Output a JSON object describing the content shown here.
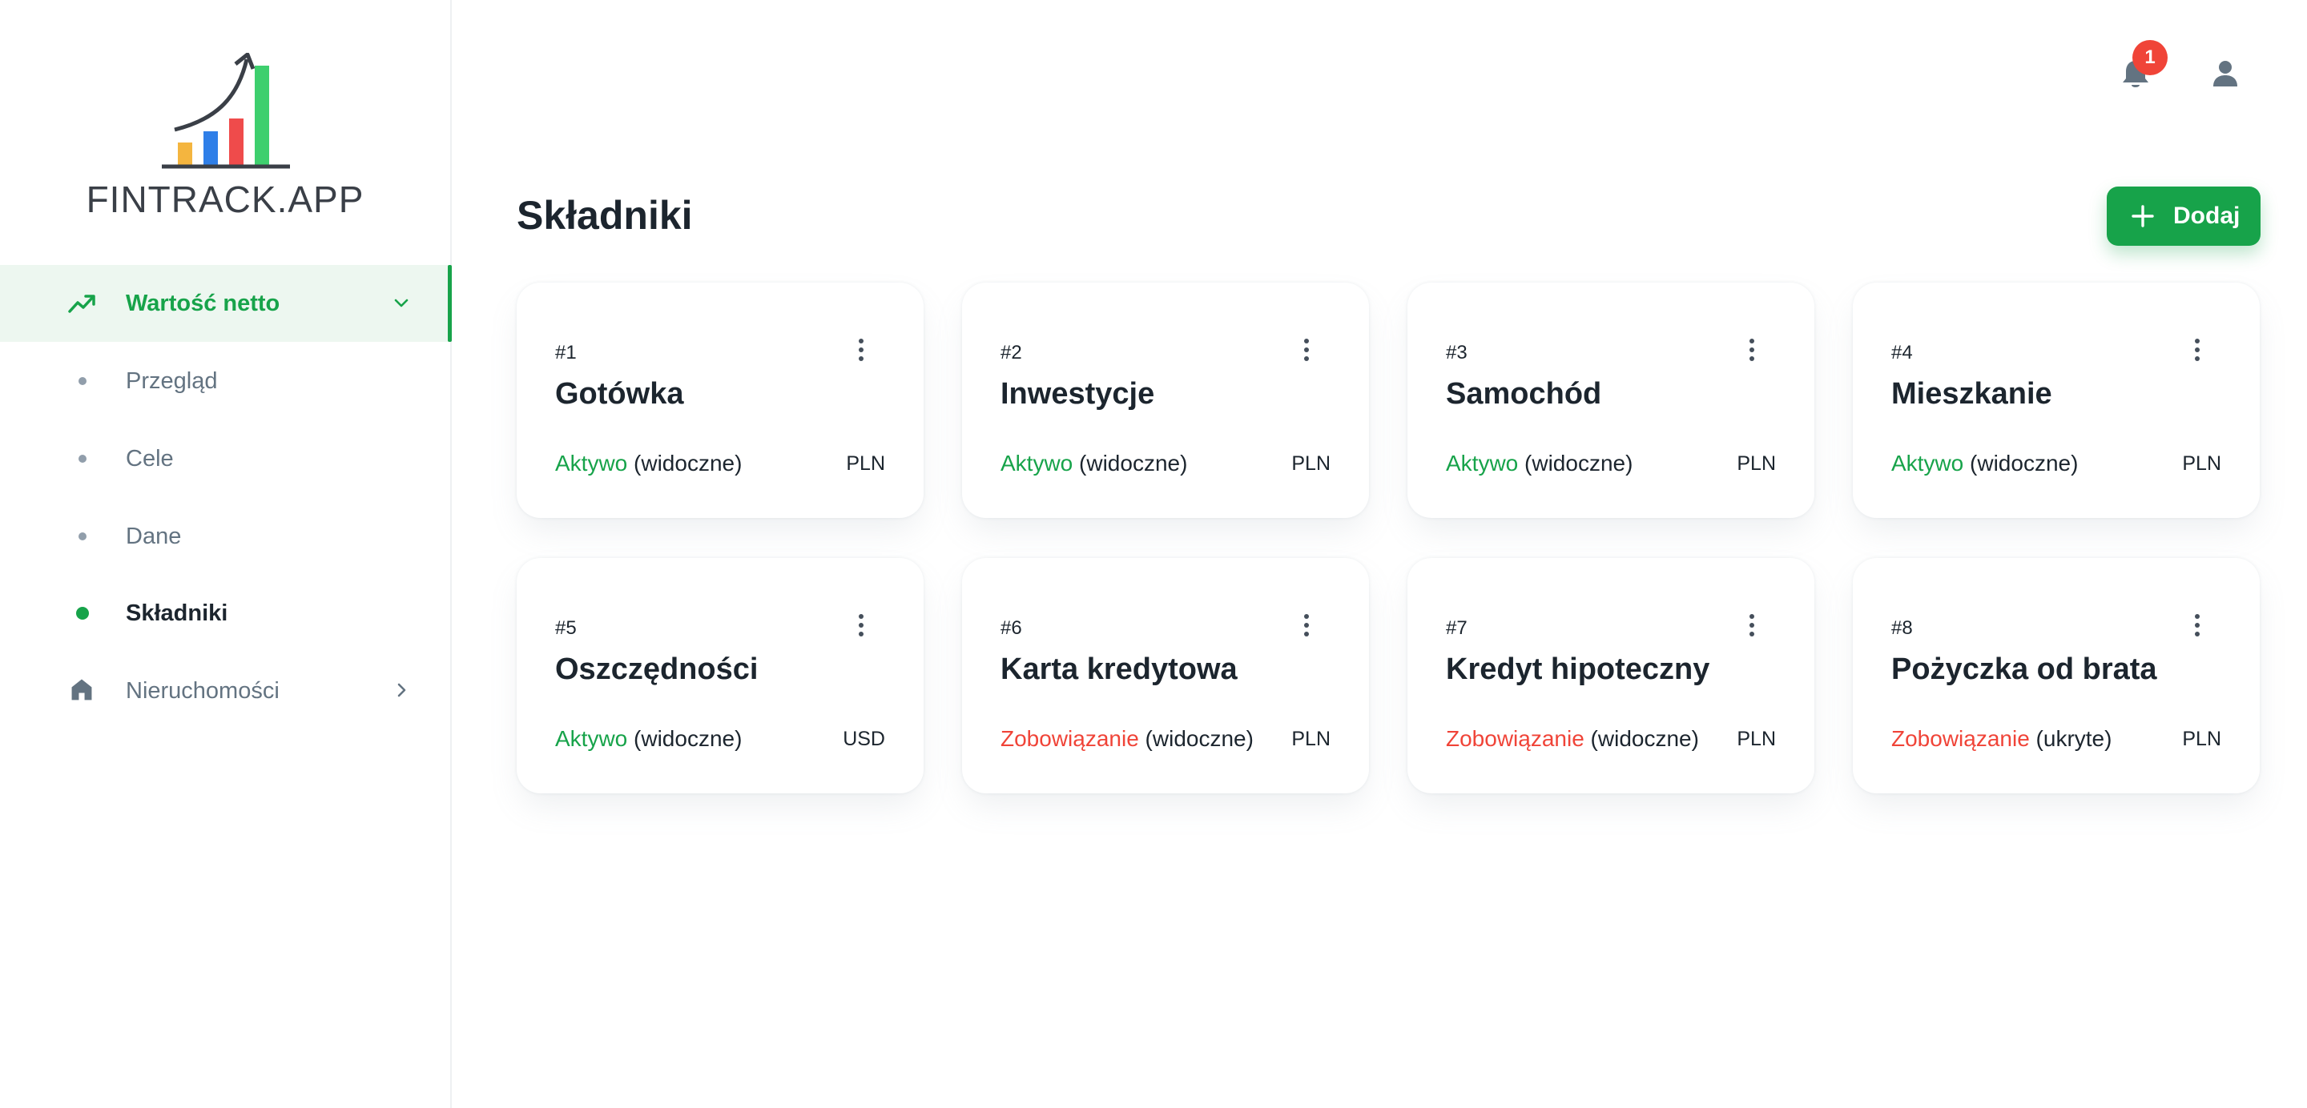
{
  "app": {
    "logo_text": "FINTRACK.APP"
  },
  "colors": {
    "accent": "#17a34a",
    "danger": "#f04438",
    "muted": "#637381"
  },
  "sidebar": {
    "items": [
      {
        "label": "Wartość netto",
        "icon": "trending-up-icon",
        "expanded": true
      },
      {
        "label": "Przegląd"
      },
      {
        "label": "Cele"
      },
      {
        "label": "Dane"
      },
      {
        "label": "Składniki",
        "current": true
      },
      {
        "label": "Nieruchomości",
        "icon": "home-icon"
      }
    ]
  },
  "topbar": {
    "notifications_count": "1"
  },
  "header": {
    "title": "Składniki",
    "add_label": "Dodaj"
  },
  "cards": [
    {
      "num": "#1",
      "name": "Gotówka",
      "kind": "Aktywo",
      "visibility": " (widoczne)",
      "currency": "PLN"
    },
    {
      "num": "#2",
      "name": "Inwestycje",
      "kind": "Aktywo",
      "visibility": " (widoczne)",
      "currency": "PLN"
    },
    {
      "num": "#3",
      "name": "Samochód",
      "kind": "Aktywo",
      "visibility": " (widoczne)",
      "currency": "PLN"
    },
    {
      "num": "#4",
      "name": "Mieszkanie",
      "kind": "Aktywo",
      "visibility": " (widoczne)",
      "currency": "PLN"
    },
    {
      "num": "#5",
      "name": "Oszczędności",
      "kind": "Aktywo",
      "visibility": " (widoczne)",
      "currency": "USD"
    },
    {
      "num": "#6",
      "name": "Karta kredytowa",
      "kind": "Zobowiązanie",
      "visibility": " (widoczne)",
      "currency": "PLN"
    },
    {
      "num": "#7",
      "name": "Kredyt hipoteczny",
      "kind": "Zobowiązanie",
      "visibility": " (widoczne)",
      "currency": "PLN"
    },
    {
      "num": "#8",
      "name": "Pożyczka od brata",
      "kind": "Zobowiązanie",
      "visibility": " (ukryte)",
      "currency": "PLN"
    }
  ]
}
